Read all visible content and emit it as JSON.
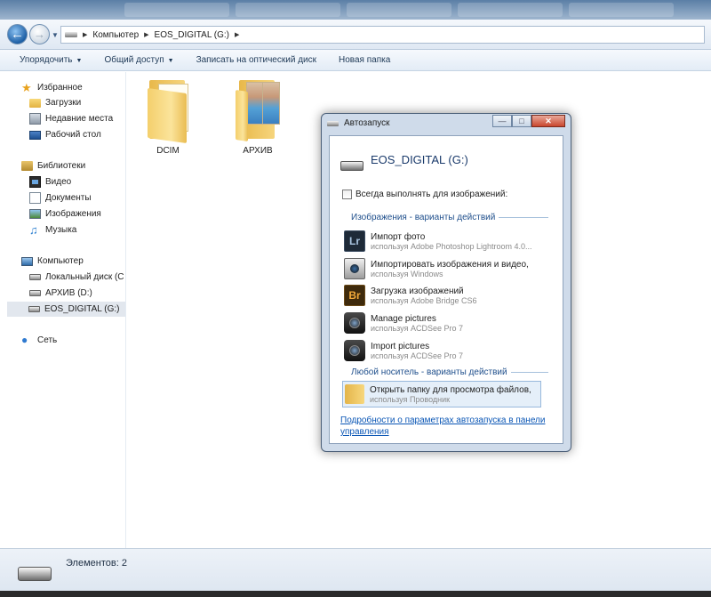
{
  "address": {
    "path": [
      "Компьютер",
      "EOS_DIGITAL (G:)"
    ]
  },
  "toolbar": {
    "organize": "Упорядочить",
    "share": "Общий доступ",
    "burn": "Записать на оптический диск",
    "new_folder": "Новая папка"
  },
  "sidebar": {
    "favorites": {
      "title": "Избранное",
      "items": [
        "Загрузки",
        "Недавние места",
        "Рабочий стол"
      ]
    },
    "libraries": {
      "title": "Библиотеки",
      "items": [
        "Видео",
        "Документы",
        "Изображения",
        "Музыка"
      ]
    },
    "computer": {
      "title": "Компьютер",
      "items": [
        "Локальный диск (C",
        "АРХИВ (D:)",
        "EOS_DIGITAL (G:)"
      ],
      "selected": "EOS_DIGITAL (G:)"
    },
    "network": {
      "title": "Сеть"
    }
  },
  "content": {
    "folders": [
      {
        "name": "DCIM",
        "icon": "folder-icon"
      },
      {
        "name": "АРХИВ",
        "icon": "photo-folder-icon"
      }
    ]
  },
  "autoplay": {
    "title": "Автозапуск",
    "drive_name": "EOS_DIGITAL (G:)",
    "always_do": "Всегда выполнять для изображений:",
    "always_checked": false,
    "images_section": "Изображения - варианты действий",
    "actions": [
      {
        "main": "Импорт фото",
        "sub": "используя Adobe Photoshop Lightroom 4.0...",
        "icon": "lightroom-icon"
      },
      {
        "main": "Импортировать изображения и видео,",
        "sub": "используя Windows",
        "icon": "scanner-camera-icon"
      },
      {
        "main": "Загрузка изображений",
        "sub": "используя Adobe Bridge CS6",
        "icon": "bridge-icon"
      },
      {
        "main": "Manage pictures",
        "sub": "используя ACDSee Pro 7",
        "icon": "camera-icon"
      },
      {
        "main": "Import pictures",
        "sub": "используя ACDSee Pro 7",
        "icon": "camera-icon"
      }
    ],
    "general_section": "Любой носитель - варианты действий",
    "open_folder": {
      "main": "Открыть папку для просмотра файлов,",
      "sub": "используя Проводник"
    },
    "link": "Подробности о параметрах автозапуска в панели управления"
  },
  "status": {
    "items_count": "Элементов: 2"
  }
}
